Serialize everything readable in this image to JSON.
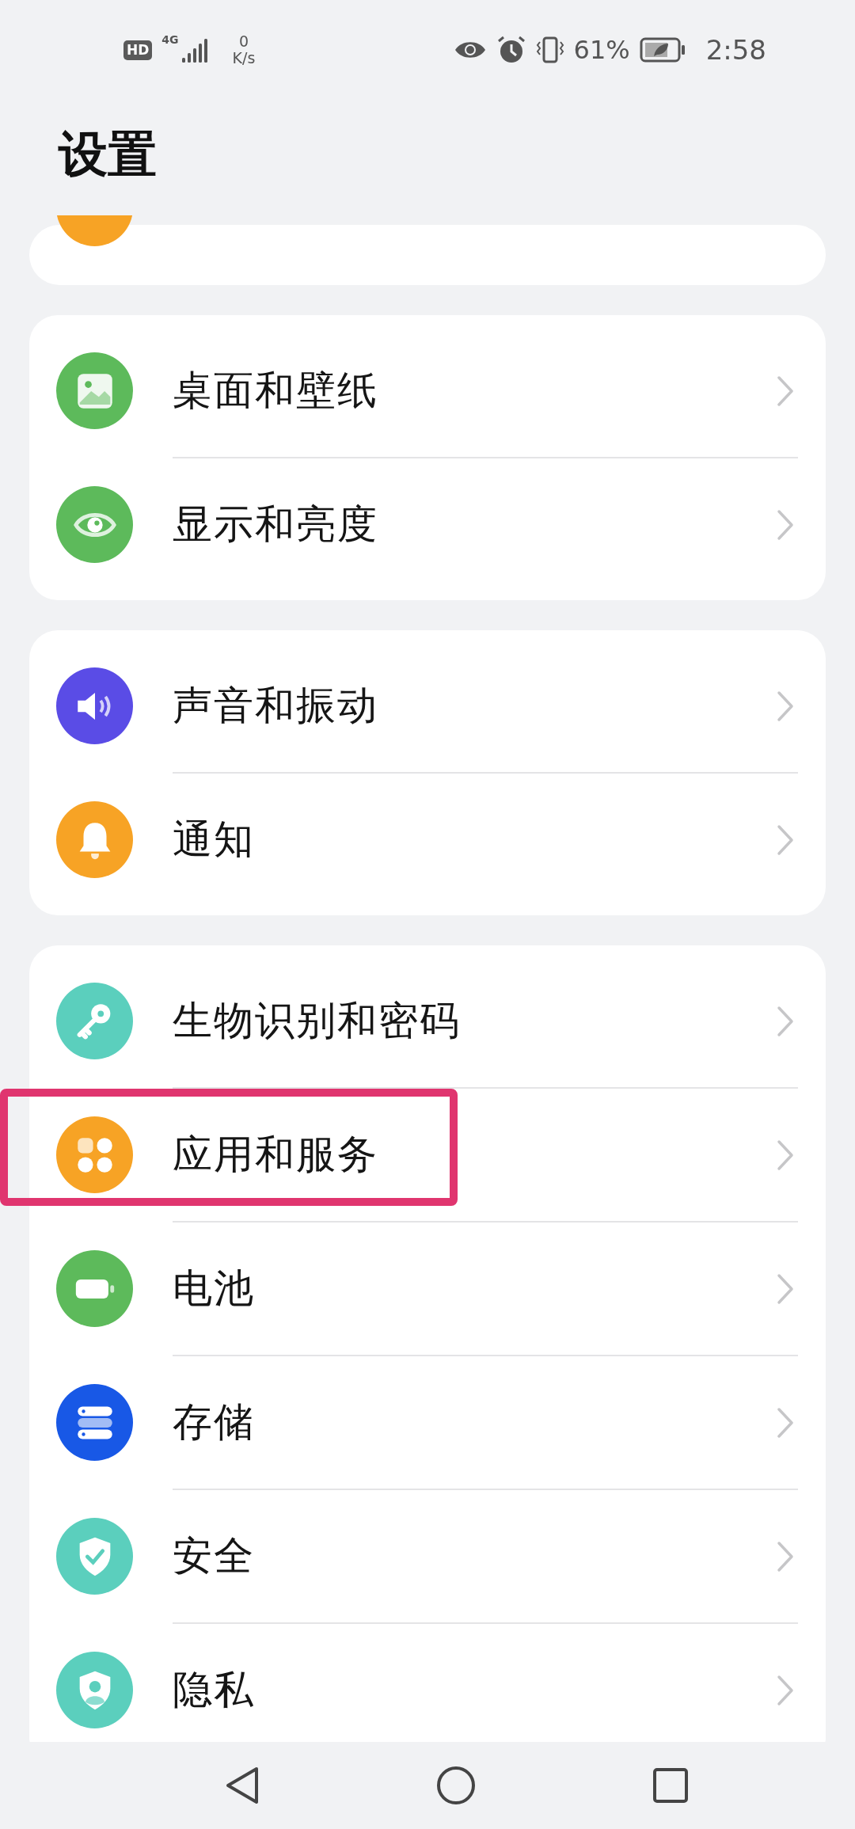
{
  "status_bar": {
    "network_badge": "HD",
    "network_type": "4G",
    "speed_value": "0",
    "speed_unit": "K/s",
    "battery": "61%",
    "time": "2:58"
  },
  "title": "设置",
  "partial_item": {
    "color": "#f7a325"
  },
  "groups": [
    {
      "items": [
        {
          "label": "桌面和壁纸",
          "kind": "wallpaper",
          "color": "#5dba5b",
          "highlighted": false
        },
        {
          "label": "显示和亮度",
          "kind": "eye",
          "color": "#5dba5b",
          "highlighted": false
        }
      ]
    },
    {
      "items": [
        {
          "label": "声音和振动",
          "kind": "speaker",
          "color": "#5a4ce6",
          "highlighted": false
        },
        {
          "label": "通知",
          "kind": "bell",
          "color": "#f7a325",
          "highlighted": false
        }
      ]
    },
    {
      "items": [
        {
          "label": "生物识别和密码",
          "kind": "key",
          "color": "#5bcfbd",
          "highlighted": false
        },
        {
          "label": "应用和服务",
          "kind": "apps",
          "color": "#f7a325",
          "highlighted": true
        },
        {
          "label": "电池",
          "kind": "battery",
          "color": "#5dba5b",
          "highlighted": false
        },
        {
          "label": "存储",
          "kind": "storage",
          "color": "#1858e6",
          "highlighted": false
        },
        {
          "label": "安全",
          "kind": "shield-check",
          "color": "#5bcfbd",
          "highlighted": false
        },
        {
          "label": "隐私",
          "kind": "shield-person",
          "color": "#5bcfbd",
          "highlighted": false
        }
      ]
    }
  ]
}
